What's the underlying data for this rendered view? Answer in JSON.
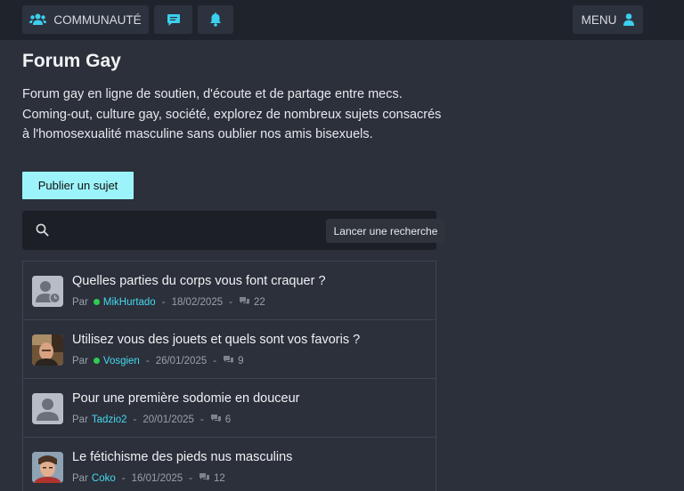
{
  "header": {
    "community_label": "COMMUNAUTÉ",
    "menu_label": "MENU",
    "accent": "#3ccfee"
  },
  "page": {
    "title": "Forum Gay",
    "description": "Forum gay en ligne de soutien, d'écoute et de partage entre mecs. Coming-out, culture gay, société, explorez de nombreux sujets consacrés à l'homosexualité masculine sans oublier nos amis bisexuels.",
    "publish_label": "Publier un sujet"
  },
  "search": {
    "placeholder": "",
    "button_label": "Lancer une recherche"
  },
  "topics": [
    {
      "title": "Quelles parties du corps vous font craquer ?",
      "by": "Par",
      "author": "MikHurtado",
      "online": true,
      "date": "18/02/2025",
      "comments": "22",
      "avatar": "default-pending"
    },
    {
      "title": "Utilisez vous des jouets et quels sont vos favoris ?",
      "by": "Par",
      "author": "Vosgien",
      "online": true,
      "date": "26/01/2025",
      "comments": "9",
      "avatar": "photo"
    },
    {
      "title": "Pour une première sodomie en douceur",
      "by": "Par",
      "author": "Tadzio2",
      "online": false,
      "date": "20/01/2025",
      "comments": "6",
      "avatar": "default"
    },
    {
      "title": "Le fétichisme des pieds nus masculins",
      "by": "Par",
      "author": "Coko",
      "online": false,
      "date": "16/01/2025",
      "comments": "12",
      "avatar": "photo"
    }
  ]
}
